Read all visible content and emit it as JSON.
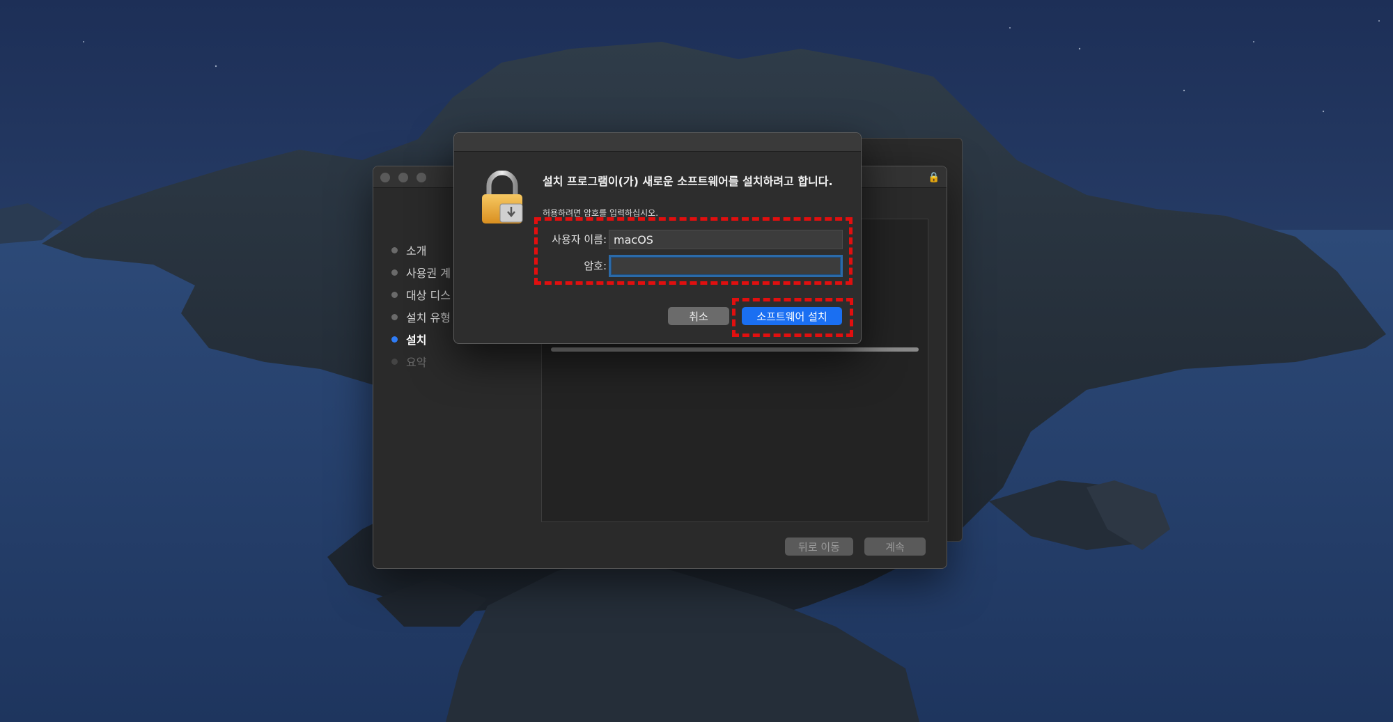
{
  "background_window": {
    "steps": [
      {
        "label": "소개",
        "state": "done"
      },
      {
        "label": "사용권 계",
        "state": "done"
      },
      {
        "label": "대상 디스",
        "state": "done"
      },
      {
        "label": "설치 유형",
        "state": "done"
      },
      {
        "label": "설치",
        "state": "active"
      },
      {
        "label": "요약",
        "state": "pending"
      }
    ],
    "back_button": "뒤로 이동",
    "continue_button": "계속"
  },
  "auth_dialog": {
    "title": "설치 프로그램이(가) 새로운 소프트웨어를 설치하려고 합니다.",
    "subtitle": "허용하려면 암호를 입력하십시오.",
    "username_label": "사용자 이름:",
    "username_value": "macOS",
    "password_label": "암호:",
    "password_value": "",
    "cancel_button": "취소",
    "install_button": "소프트웨어 설치"
  },
  "colors": {
    "accent": "#1a6ff2",
    "highlight": "#e10f0f",
    "active_step": "#2f7cf6"
  }
}
